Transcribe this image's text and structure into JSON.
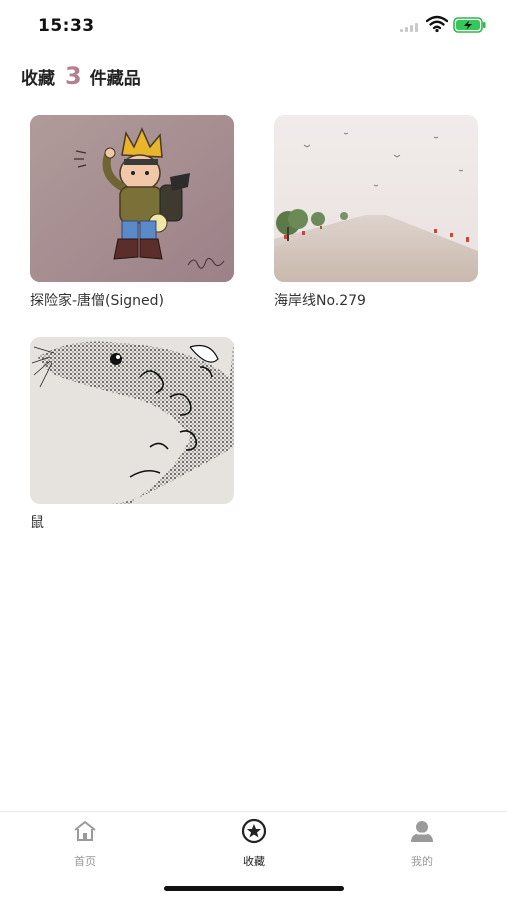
{
  "status_bar": {
    "time": "15:33"
  },
  "header": {
    "prefix": "收藏",
    "count": "3",
    "suffix": "件藏品"
  },
  "items": [
    {
      "title": "探险家-唐僧(Signed)",
      "image": "cartoon-explorer-drawing"
    },
    {
      "title": "海岸线No.279",
      "image": "coastal-road-photo"
    },
    {
      "title": "鼠",
      "image": "ink-rat-drawing"
    }
  ],
  "tabs": [
    {
      "label": "首页",
      "icon": "home-icon",
      "active": false
    },
    {
      "label": "收藏",
      "icon": "star-badge-icon",
      "active": true
    },
    {
      "label": "我的",
      "icon": "user-icon",
      "active": false
    }
  ],
  "colors": {
    "accent": "#b57f92",
    "tab_active": "#222222",
    "tab_inactive": "#9a9a9a"
  }
}
